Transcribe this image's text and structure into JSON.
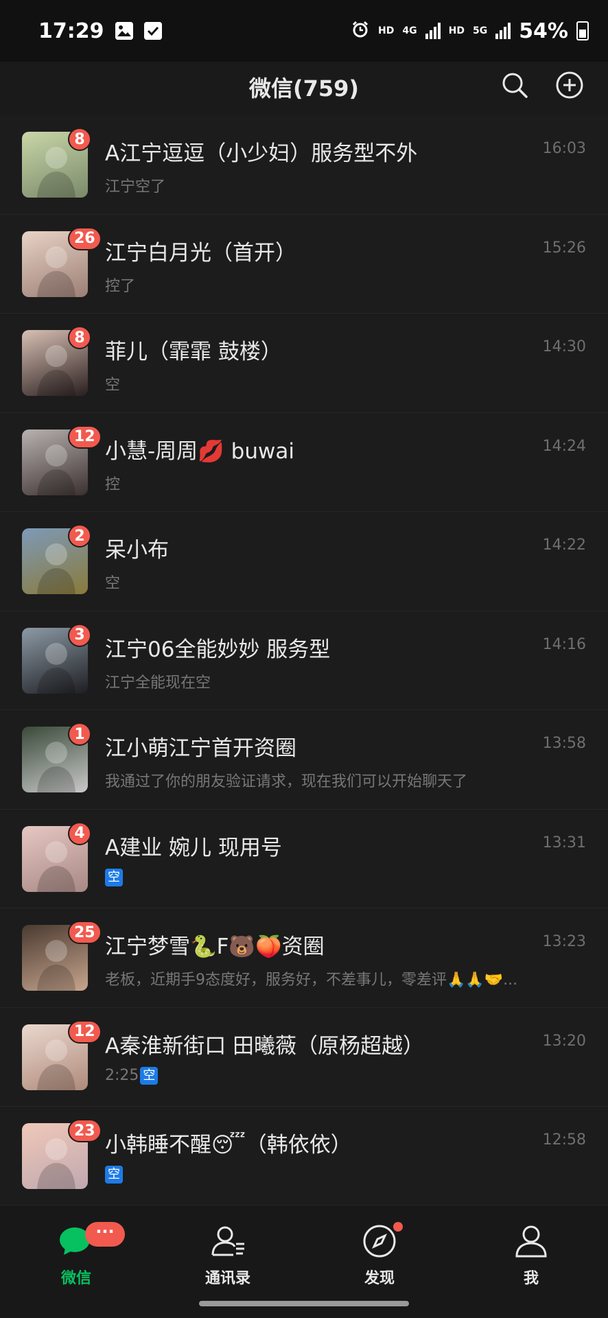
{
  "status_bar": {
    "time": "17:29",
    "battery": "54%",
    "net1": "HD",
    "net2": "4G",
    "net3": "HD",
    "net4": "5G"
  },
  "header": {
    "title": "微信(759)",
    "search_icon": "search-icon",
    "add_icon": "plus-circle-icon"
  },
  "chats": [
    {
      "name": "A江宁逗逗（小少妇）服务型不外",
      "preview": "江宁空了",
      "time": "16:03",
      "badge": "8",
      "avatar_colors": [
        "#c9d6a8",
        "#7a8a6a"
      ]
    },
    {
      "name": "江宁白月光（首开）",
      "preview": "控了",
      "time": "15:26",
      "badge": "26",
      "avatar_colors": [
        "#e8d2c6",
        "#9c7f74"
      ]
    },
    {
      "name": "菲儿（霏霏 鼓楼）",
      "preview": "空",
      "time": "14:30",
      "badge": "8",
      "avatar_colors": [
        "#d8c0b4",
        "#2a1f1f"
      ]
    },
    {
      "name": "小慧-周周💋 buwai",
      "preview": "控",
      "time": "14:24",
      "badge": "12",
      "avatar_colors": [
        "#b9b2b0",
        "#3b3030"
      ]
    },
    {
      "name": "呆小布",
      "preview": "空",
      "time": "14:22",
      "badge": "2",
      "avatar_colors": [
        "#7d9ab8",
        "#8a7a3a"
      ]
    },
    {
      "name": "江宁06全能妙妙 服务型",
      "preview": "江宁全能现在空",
      "time": "14:16",
      "badge": "3",
      "avatar_colors": [
        "#8c9aa6",
        "#1e1e22"
      ]
    },
    {
      "name": "江小萌江宁首开资圈",
      "preview": "我通过了你的朋友验证请求，现在我们可以开始聊天了",
      "time": "13:58",
      "badge": "1",
      "avatar_colors": [
        "#3a4a3a",
        "#c9c9c9"
      ]
    },
    {
      "name": "A建业 婉儿 现用号",
      "preview": "空",
      "preview_is_tag": true,
      "time": "13:31",
      "badge": "4",
      "avatar_colors": [
        "#e6c7c2",
        "#a78884"
      ]
    },
    {
      "name": "江宁梦雪🐍F🐻🍑资圈",
      "preview": "老板，近期手9态度好，服务好，不差事儿，零差评🙏🙏🤝...",
      "time": "13:23",
      "badge": "25",
      "avatar_colors": [
        "#4a3a30",
        "#c7a58e"
      ]
    },
    {
      "name": "A秦淮新街口 田曦薇（原杨超越）",
      "preview": "2:25",
      "preview_tag": "空",
      "time": "13:20",
      "badge": "12",
      "avatar_colors": [
        "#ead8cf",
        "#b08a7a"
      ]
    },
    {
      "name": "小韩睡不醒😴（韩依依）",
      "preview": "空",
      "preview_is_tag": true,
      "time": "12:58",
      "badge": "23",
      "avatar_colors": [
        "#f0c8b8",
        "#c0a8b0"
      ]
    }
  ],
  "tabbar": {
    "tabs": [
      {
        "label": "微信",
        "icon": "chat-bubble-icon",
        "active": true
      },
      {
        "label": "通讯录",
        "icon": "contacts-icon",
        "active": false
      },
      {
        "label": "发现",
        "icon": "compass-icon",
        "active": false
      },
      {
        "label": "我",
        "icon": "person-icon",
        "active": false
      }
    ],
    "chat_badge": "···"
  },
  "colors": {
    "accent": "#07c160",
    "badge": "#f25a4f",
    "tag": "#1d7be6"
  }
}
